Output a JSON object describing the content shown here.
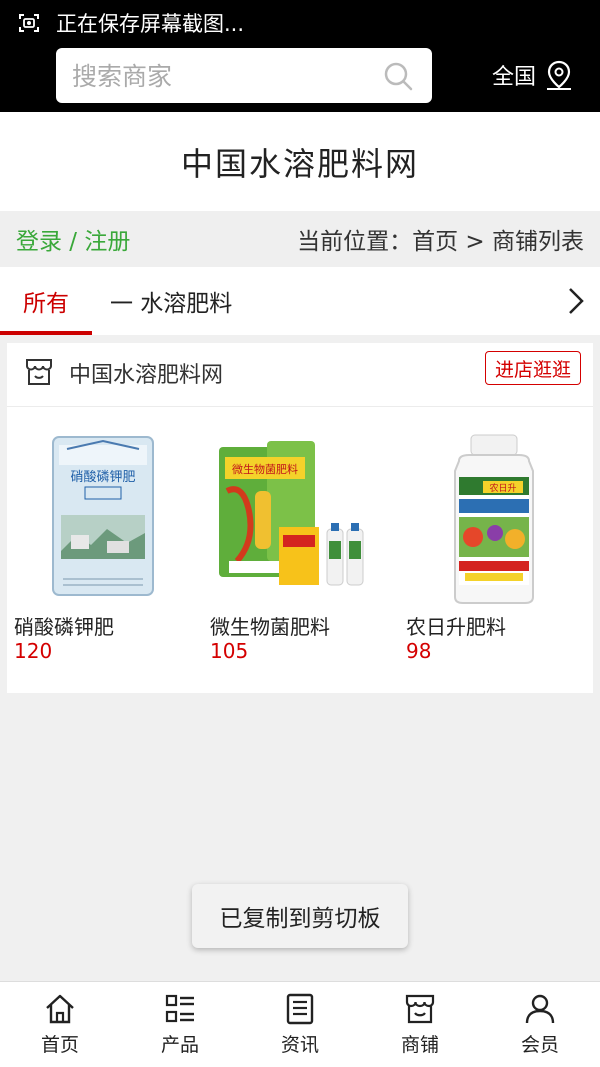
{
  "status": {
    "text": "正在保存屏幕截图..."
  },
  "search": {
    "placeholder": "搜索商家"
  },
  "region": {
    "label": "全国"
  },
  "site": {
    "title": "中国水溶肥料网"
  },
  "crumbs": {
    "login_label": "登录 / 注册",
    "location_text": "当前位置：首页 > 商铺列表"
  },
  "tabs": {
    "all_label": "所有",
    "category_label": "一 水溶肥料"
  },
  "shop": {
    "name": "中国水溶肥料网",
    "visit_label": "进店逛逛",
    "products": [
      {
        "name": "硝酸磷钾肥",
        "price": "120",
        "image_text": "硝酸磷钾肥"
      },
      {
        "name": "微生物菌肥料",
        "price": "105",
        "image_text": "微生物菌肥料"
      },
      {
        "name": "农日升肥料",
        "price": "98",
        "image_text": "农日升"
      }
    ]
  },
  "toast": {
    "text": "已复制到剪切板"
  },
  "nav": {
    "items": [
      {
        "label": "首页",
        "icon": "home-icon"
      },
      {
        "label": "产品",
        "icon": "list-icon"
      },
      {
        "label": "资讯",
        "icon": "news-icon"
      },
      {
        "label": "商铺",
        "icon": "shop-icon"
      },
      {
        "label": "会员",
        "icon": "user-icon"
      }
    ]
  },
  "colors": {
    "accent_red": "#d40000",
    "login_green": "#3aa83a",
    "header_black": "#000000"
  }
}
